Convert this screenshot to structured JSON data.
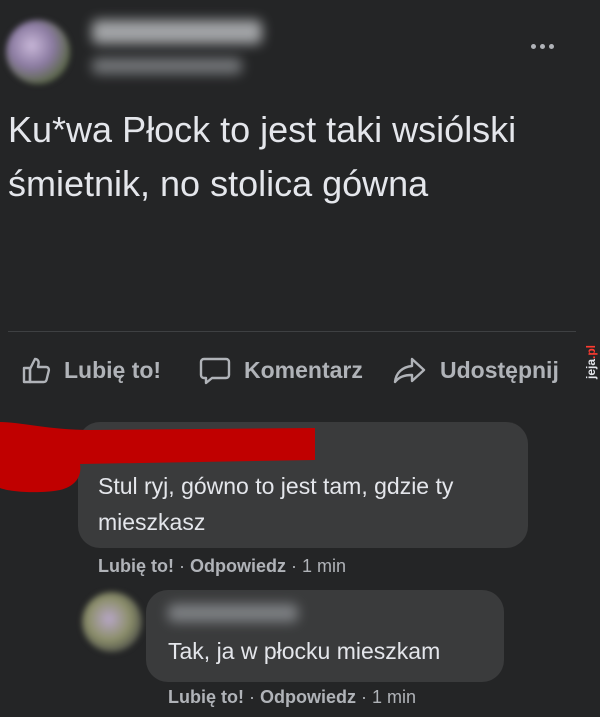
{
  "post": {
    "text": "Ku*wa Płock to jest taki wsiólski śmietnik, no stolica gówna",
    "more_icon": "more-horizontal-icon"
  },
  "actions": {
    "like_label": "Lubię to!",
    "comment_label": "Komentarz",
    "share_label": "Udostępnij"
  },
  "watermark": {
    "text_main": "jeja",
    "text_suffix": ".pl"
  },
  "comments": [
    {
      "text": "Stul ryj, gówno to jest tam, gdzie ty mieszkasz",
      "like": "Lubię to!",
      "sep1": " · ",
      "reply": "Odpowiedz",
      "sep2": " · ",
      "time": "1 min"
    },
    {
      "text": "Tak, ja w płocku mieszkam",
      "like": "Lubię to!",
      "sep1": " · ",
      "reply": "Odpowiedz",
      "sep2": " · ",
      "time": "1 min"
    }
  ],
  "colors": {
    "background": "#242526",
    "bubble": "#3a3b3c",
    "text": "#e4e6eb",
    "secondary": "#b0b3b8",
    "redaction": "#c00000"
  }
}
